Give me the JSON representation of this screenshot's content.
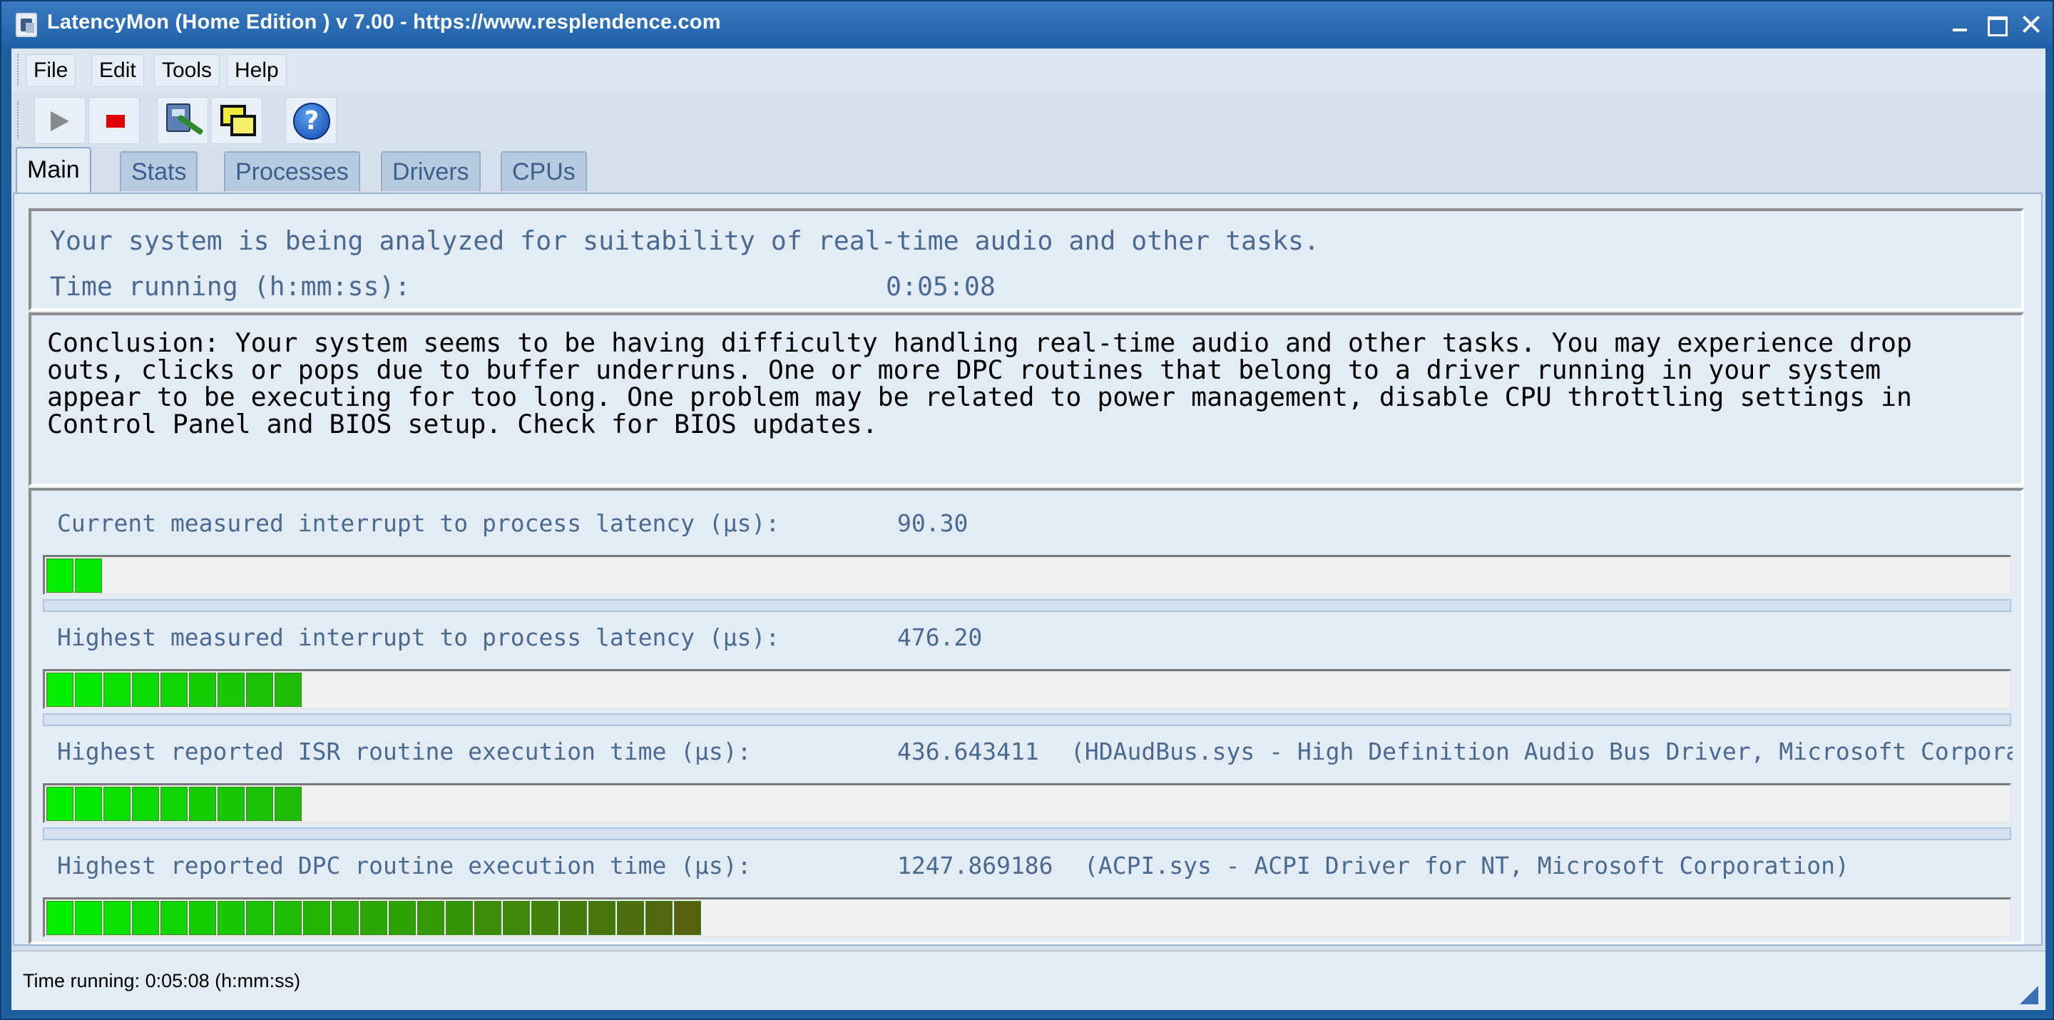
{
  "window": {
    "title": "LatencyMon  (Home Edition )  v 7.00 - https://www.resplendence.com"
  },
  "menu": [
    "File",
    "Edit",
    "Tools",
    "Help"
  ],
  "toolbar": {
    "icons": [
      "play-icon",
      "stop-icon",
      "report-icon",
      "windows-icon",
      "help-icon"
    ],
    "help_glyph": "?"
  },
  "tabs": [
    "Main",
    "Stats",
    "Processes",
    "Drivers",
    "CPUs"
  ],
  "main": {
    "analyzing": "Your system is being analyzed for suitability of real-time audio and other tasks.",
    "time_label": "Time running (h:mm:ss):",
    "time_value": "0:05:08",
    "conclusion": "Conclusion: Your system seems to be having difficulty handling real-time audio and other tasks. You may experience drop\nouts, clicks or pops due to buffer underruns. One or more DPC routines that belong to a driver running in your system\nappear to be executing for too long. One problem may be related to power management, disable CPU throttling settings in\nControl Panel and BIOS setup. Check for BIOS updates."
  },
  "metrics": [
    {
      "label": "Current measured interrupt to process latency (µs):",
      "value": "90.30",
      "extra": "",
      "segments": 2
    },
    {
      "label": "Highest measured interrupt to process latency (µs):",
      "value": "476.20",
      "extra": "",
      "segments": 9
    },
    {
      "label": "Highest reported ISR routine execution time (µs):",
      "value": "436.643411",
      "extra": "(HDAudBus.sys - High Definition Audio Bus Driver, Microsoft Corpora",
      "segments": 9
    },
    {
      "label": "Highest reported DPC routine execution time (µs):",
      "value": "1247.869186",
      "extra": "(ACPI.sys - ACPI Driver for NT, Microsoft Corporation)",
      "segments": 23
    }
  ],
  "status": {
    "text": "Time running: 0:05:08  (h:mm:ss)"
  },
  "colors": {
    "bar_green": "#00ee00",
    "bar_dark": "#5a5a10",
    "title_bar": "#2a6bb3"
  }
}
